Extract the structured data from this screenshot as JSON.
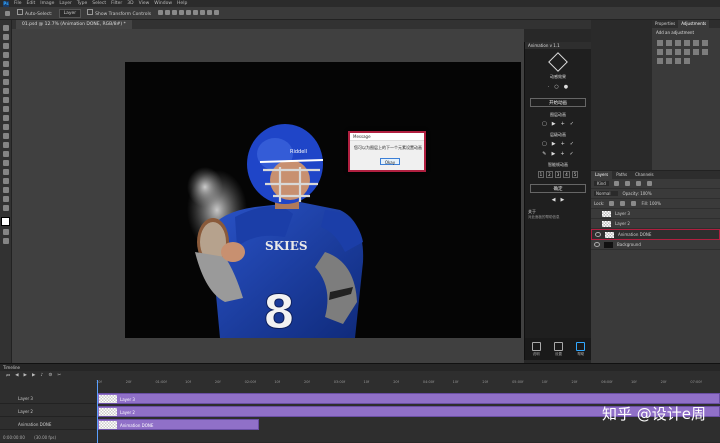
{
  "menubar": {
    "logo": "Ps",
    "items": [
      "File",
      "Edit",
      "Image",
      "Layer",
      "Type",
      "Select",
      "Filter",
      "3D",
      "View",
      "Window",
      "Help"
    ]
  },
  "options": {
    "auto_select": "Auto-Select:",
    "layer_value": "Layer",
    "transform": "Show Transform Controls"
  },
  "document": {
    "tab": "01.psd @ 12.7% (Animation DONE, RGB/8#) *"
  },
  "dialog": {
    "title": "Message",
    "message": "您可以为图层上的下一个元素设置动画",
    "ok": "Okay"
  },
  "plugin": {
    "header": "Animation v 1.1",
    "brand": "动感效果",
    "btn_main": "开始动画",
    "label1": "图层动画",
    "label2": "层级动画",
    "label3": "智能帧动画",
    "nums": [
      "1",
      "2",
      "3",
      "4",
      "5"
    ],
    "btn_apply": "确定",
    "help_title": "关于",
    "help_text": "对此面板的帮助信息",
    "foot": [
      "说明",
      "设置",
      "帮助"
    ]
  },
  "right": {
    "top_tabs": [
      "Properties",
      "Adjustments"
    ],
    "adj_label": "Add an adjustment",
    "layer_tabs": [
      "Layers",
      "Paths",
      "Channels"
    ],
    "kind": "Kind",
    "blend": "Normal",
    "opacity": "Opacity: 100%",
    "lock": "Lock:",
    "fill": "Fill: 100%",
    "layers": [
      "Layer 3",
      "Layer 2",
      "Animation DONE",
      "Background"
    ]
  },
  "status": {
    "zoom": "12.53%",
    "doc": "Doc: 2.25M/8.79M"
  },
  "timeline": {
    "title": "Timeline",
    "timecode": "0:00:00:00",
    "fps": "(30.00 fps)",
    "ruler": [
      "10f",
      "20f",
      "01:00f",
      "10f",
      "20f",
      "02:00f",
      "10f",
      "20f",
      "03:00f",
      "10f",
      "20f",
      "04:00f",
      "10f",
      "20f",
      "05:00f",
      "10f",
      "20f",
      "06:00f",
      "10f",
      "20f",
      "07:00f"
    ],
    "tracks": [
      "Layer 3",
      "Layer 2",
      "Animation DONE"
    ],
    "clips": [
      "Layer 3",
      "Layer 2",
      "Animation DONE"
    ]
  },
  "watermark": "知乎 @设计e周",
  "colors": {
    "accent": "#31a8ff",
    "clip": "#9070c8",
    "highlight": "#b02040"
  }
}
